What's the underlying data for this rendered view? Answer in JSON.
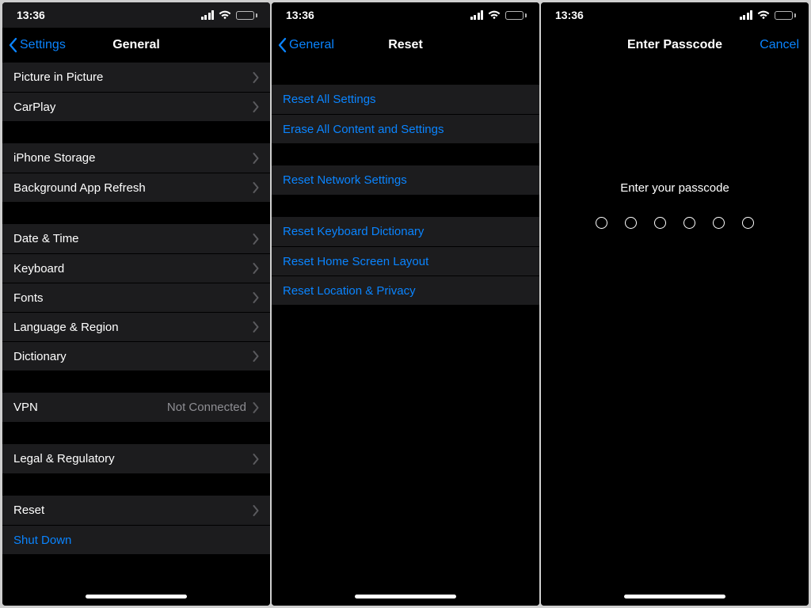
{
  "status": {
    "time": "13:36"
  },
  "screen1": {
    "back": "Settings",
    "title": "General",
    "rows": {
      "pip": "Picture in Picture",
      "carplay": "CarPlay",
      "storage": "iPhone Storage",
      "bgrefresh": "Background App Refresh",
      "datetime": "Date & Time",
      "keyboard": "Keyboard",
      "fonts": "Fonts",
      "langregion": "Language & Region",
      "dictionary": "Dictionary",
      "vpn_label": "VPN",
      "vpn_value": "Not Connected",
      "legal": "Legal & Regulatory",
      "reset": "Reset",
      "shutdown": "Shut Down"
    }
  },
  "screen2": {
    "back": "General",
    "title": "Reset",
    "rows": {
      "all": "Reset All Settings",
      "erase": "Erase All Content and Settings",
      "network": "Reset Network Settings",
      "keyboard": "Reset Keyboard Dictionary",
      "home": "Reset Home Screen Layout",
      "location": "Reset Location & Privacy"
    }
  },
  "screen3": {
    "title": "Enter Passcode",
    "cancel": "Cancel",
    "prompt": "Enter your passcode",
    "digits": 6
  }
}
